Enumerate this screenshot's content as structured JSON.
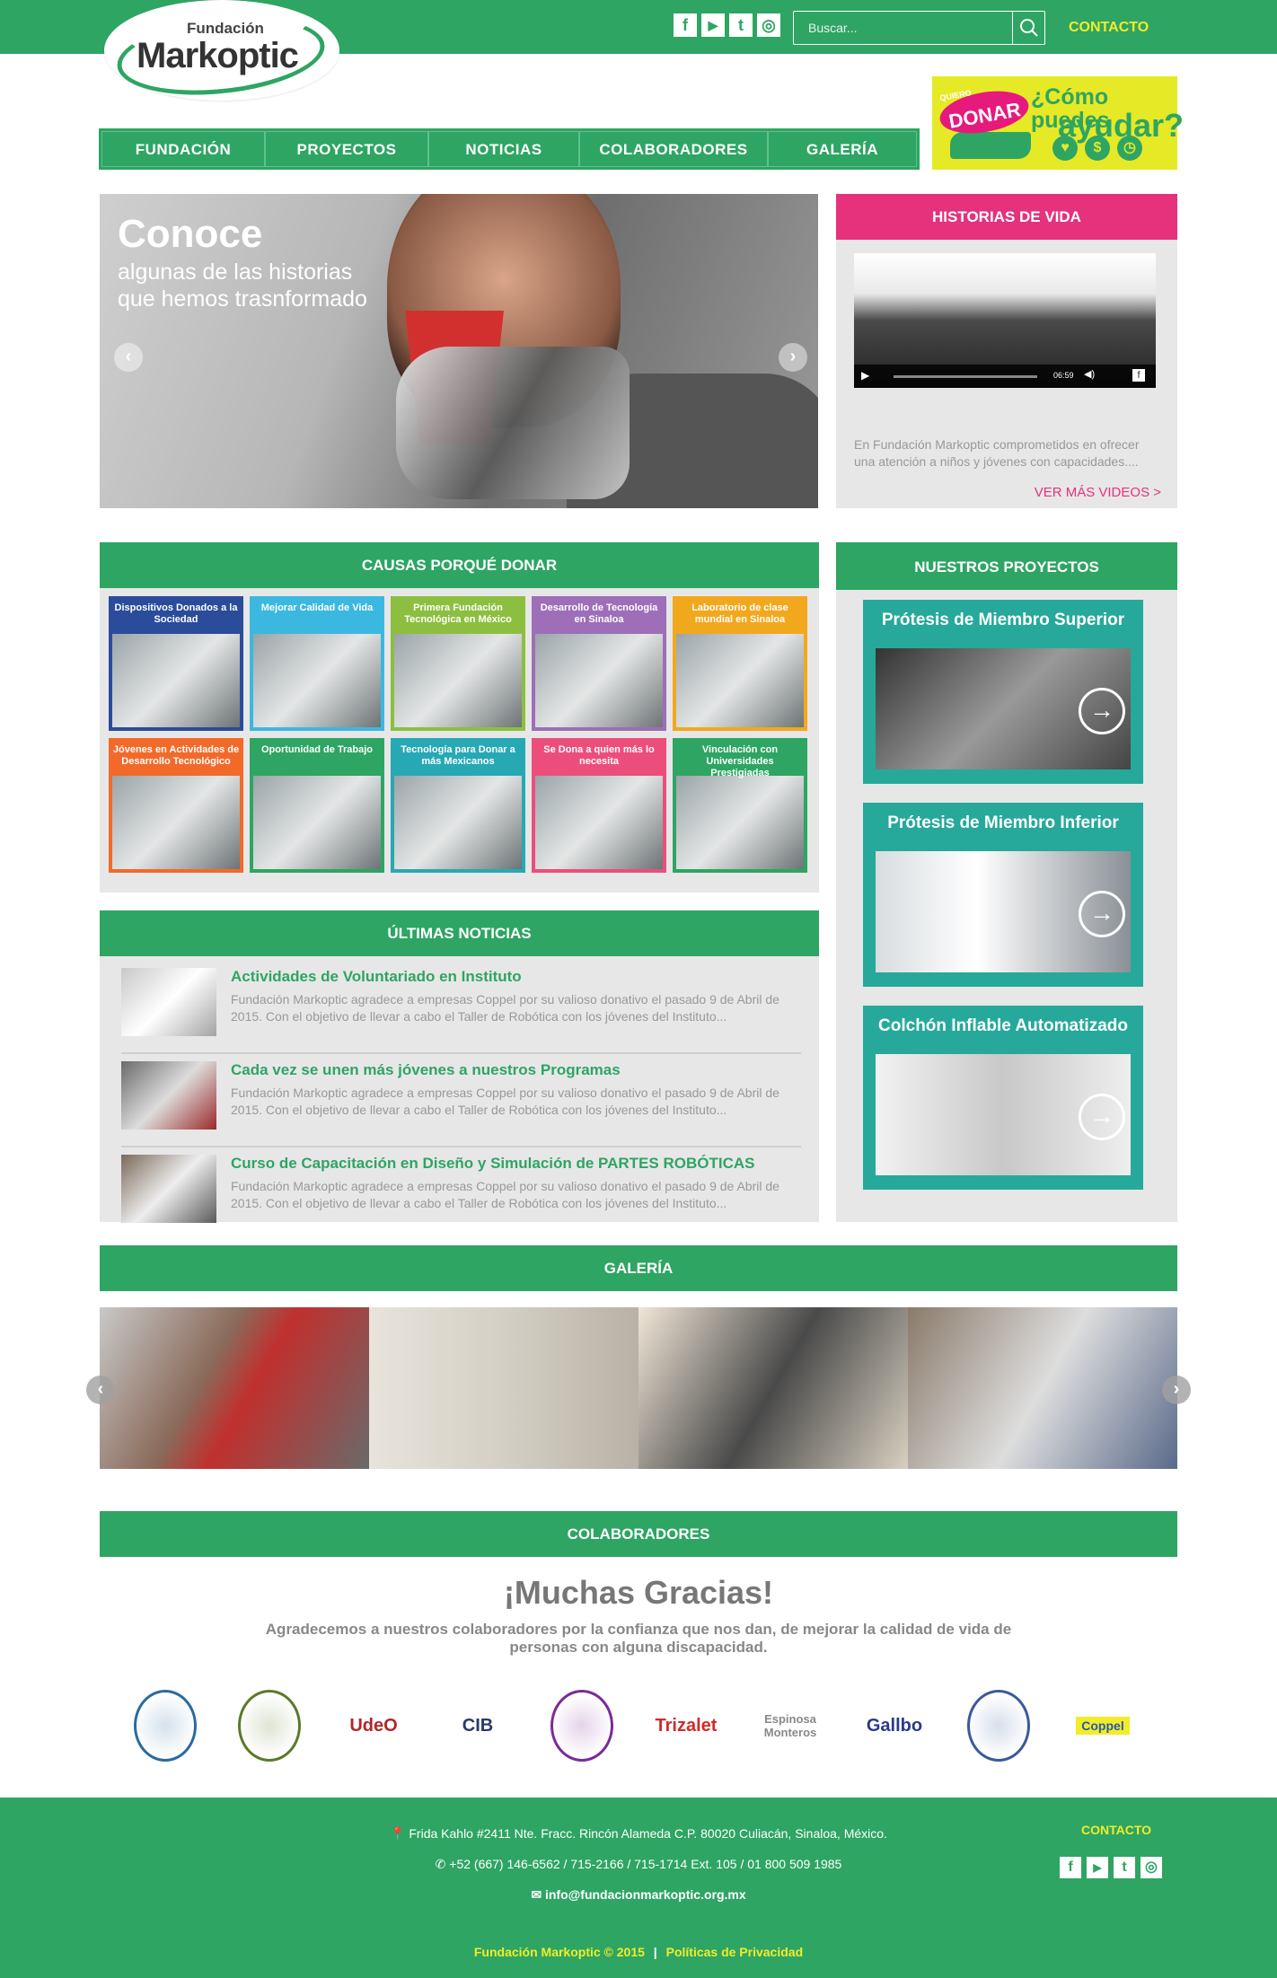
{
  "header": {
    "logo_small": "Fundación",
    "logo_big": "Markoptic",
    "search_placeholder": "Buscar...",
    "contact": "CONTACTO",
    "social": [
      "f",
      "▶",
      "t",
      "◎"
    ]
  },
  "donate": {
    "quiero": "QUIERO",
    "donar": "DONAR",
    "line1": "¿Cómo puedes",
    "line2": "ayudar?"
  },
  "nav": [
    "FUNDACIÓN",
    "PROYECTOS",
    "NOTICIAS",
    "COLABORADORES",
    "GALERÍA"
  ],
  "hero": {
    "title": "Conoce",
    "subtitle1": "algunas de las historias",
    "subtitle2": "que hemos trasnformado"
  },
  "historias": {
    "title": "HISTORIAS DE VIDA",
    "time": "06:59",
    "text": "En Fundación Markoptic comprometidos en ofrecer una atención a niños y jóvenes con capacidades....",
    "more": "VER MÁS VIDEOS >"
  },
  "causas": {
    "title": "CAUSAS PORQUÉ DONAR",
    "tiles": [
      {
        "label": "Dispositivos Donados a la Sociedad",
        "color": "#2a4c9a"
      },
      {
        "label": "Mejorar Calidad de Vida",
        "color": "#3bb8e0"
      },
      {
        "label": "Primera Fundación Tecnológica en México",
        "color": "#8cbf3f"
      },
      {
        "label": "Desarrollo de Tecnología en Sinaloa",
        "color": "#9e6eb8"
      },
      {
        "label": "Laboratorio de clase mundial en Sinaloa",
        "color": "#f2a81d"
      },
      {
        "label": "Jóvenes en Actividades de Desarrollo Tecnológico",
        "color": "#f26a2a"
      },
      {
        "label": "Oportunidad de Trabajo",
        "color": "#2ea563"
      },
      {
        "label": "Tecnología para Donar a más Mexicanos",
        "color": "#26a9b5"
      },
      {
        "label": "Se Dona a quien más lo necesita",
        "color": "#ec4e7c"
      },
      {
        "label": "Vinculación con Universidades Prestigiadas",
        "color": "#2ea563"
      }
    ]
  },
  "proyectos": {
    "title": "NUESTROS PROYECTOS",
    "items": [
      "Prótesis de Miembro Superior",
      "Prótesis de Miembro Inferior",
      "Colchón Inflable Automatizado"
    ]
  },
  "noticias": {
    "title": "ÚLTIMAS NOTICIAS",
    "items": [
      {
        "title": "Actividades de Voluntariado en Instituto",
        "desc": "Fundación Markoptic agradece a empresas Coppel por su valioso donativo el pasado 9 de Abril de 2015. Con el objetivo de llevar a cabo el Taller de Robótica con los jóvenes del Instituto..."
      },
      {
        "title": "Cada vez se unen más jóvenes a nuestros Programas",
        "desc": "Fundación Markoptic agradece a empresas Coppel por su valioso donativo el pasado 9 de Abril de 2015. Con el objetivo de llevar a cabo el Taller de Robótica con los jóvenes del Instituto..."
      },
      {
        "title": "Curso de Capacitación en Diseño y Simulación de PARTES ROBÓTICAS",
        "desc": "Fundación Markoptic agradece a empresas Coppel por su valioso donativo el pasado 9 de Abril de 2015. Con el objetivo de llevar a cabo el Taller de Robótica con los jóvenes del Instituto..."
      }
    ]
  },
  "galeria": {
    "title": "GALERÍA"
  },
  "colaboradores": {
    "title": "COLABORADORES",
    "thanks": "¡Muchas Gracias!",
    "text": "Agradecemos a nuestros colaboradores por la confianza que nos dan, de mejorar la calidad de vida de personas con alguna discapacidad.",
    "logos": [
      {
        "name": "",
        "color": "#2a6aa0"
      },
      {
        "name": "",
        "color": "#5a7a2a"
      },
      {
        "name": "UdeO",
        "color": "#b0262b"
      },
      {
        "name": "CIB",
        "color": "#2a3a6a"
      },
      {
        "name": "",
        "color": "#7a2a9a"
      },
      {
        "name": "Trizalet",
        "color": "#d42a2a"
      },
      {
        "name": "Espinosa Monteros",
        "color": "#888888"
      },
      {
        "name": "Gallbo",
        "color": "#2a3a8a"
      },
      {
        "name": "",
        "color": "#3a5a9a"
      },
      {
        "name": "Coppel",
        "color": "#2a5aa8"
      }
    ]
  },
  "footer": {
    "address": "Frida Kahlo #2411 Nte. Fracc. Rincón Alameda C.P. 80020 Culiacán, Sinaloa, México.",
    "phone": "+52 (667) 146-6562 /  715-2166  / 715-1714  Ext. 105  / 01 800 509 1985",
    "email": "info@fundacionmarkoptic.org.mx",
    "contact": "CONTACTO",
    "copyright": "Fundación Markoptic © 2015",
    "privacy": "Políticas de Privacidad"
  },
  "colors": {
    "green": "#2ea563",
    "pink": "#e6317d",
    "yellow": "#f2ec2b",
    "teal": "#26a99a"
  }
}
